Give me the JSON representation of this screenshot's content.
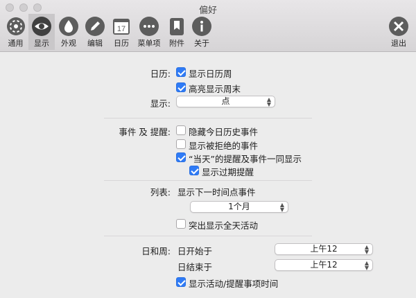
{
  "window": {
    "title": "偏好"
  },
  "toolbar": {
    "items": [
      {
        "label": "通用",
        "icon": "gear-icon"
      },
      {
        "label": "显示",
        "icon": "eye-icon",
        "selected": true
      },
      {
        "label": "外观",
        "icon": "drop-icon"
      },
      {
        "label": "编辑",
        "icon": "pencil-icon"
      },
      {
        "label": "日历",
        "icon": "calendar-icon",
        "calendar_day": "17"
      },
      {
        "label": "菜单项",
        "icon": "ellipsis-icon"
      },
      {
        "label": "附件",
        "icon": "bookmark-icon"
      },
      {
        "label": "关于",
        "icon": "info-icon"
      }
    ],
    "quit": {
      "label": "退出",
      "icon": "close-icon"
    }
  },
  "calendar": {
    "label": "日历:",
    "show_week": {
      "label": "显示日历周",
      "checked": true
    },
    "highlight_weekend": {
      "label": "高亮显示周末",
      "checked": true
    }
  },
  "display": {
    "label": "显示:",
    "value": "点"
  },
  "events": {
    "label": "事件 及 提醒:",
    "hide_past": {
      "label": "隐藏今日历史事件",
      "checked": false
    },
    "show_declined": {
      "label": "显示被拒绝的事件",
      "checked": false
    },
    "show_today_reminders": {
      "label": "“当天”的提醒及事件一同显示",
      "checked": true
    },
    "show_overdue": {
      "label": "显示过期提醒",
      "checked": true
    }
  },
  "list": {
    "label": "列表:",
    "next_events_text": "显示下一时间点事件",
    "period_value": "1个月",
    "highlight_allday": {
      "label": "突出显示全天活动",
      "checked": false
    }
  },
  "day_week": {
    "label": "日和周:",
    "day_start": {
      "label": "日开始于",
      "value": "上午12"
    },
    "day_end": {
      "label": "日结束于",
      "value": "上午12"
    },
    "show_activity_time": {
      "label": "显示活动/提醒事项时间",
      "checked": true
    }
  }
}
